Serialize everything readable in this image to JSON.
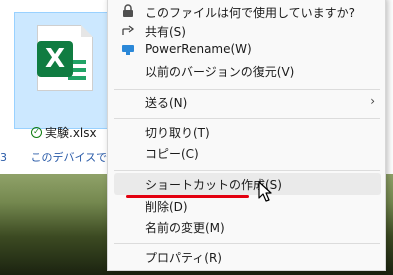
{
  "file": {
    "name": "実験.xlsx",
    "badge_letter": "X",
    "status_icon": "check-circle-icon"
  },
  "status_bar": {
    "left_number": "3",
    "text": "このデバイスで使用"
  },
  "context_menu": {
    "items": [
      {
        "label": "このファイルは何で使用していますか?",
        "icon": "lock-icon"
      },
      {
        "label": "共有(S)",
        "icon": "share-icon"
      },
      {
        "label": "PowerRename(W)",
        "icon": "powerrename-icon"
      },
      {
        "label": "以前のバージョンの復元(V)",
        "icon": ""
      },
      {
        "label": "送る(N)",
        "icon": "",
        "submenu_arrow": "›"
      },
      {
        "label": "切り取り(T)",
        "icon": ""
      },
      {
        "label": "コピー(C)",
        "icon": ""
      },
      {
        "label": "ショートカットの作成(S)",
        "icon": "",
        "highlighted": true
      },
      {
        "label": "削除(D)",
        "icon": ""
      },
      {
        "label": "名前の変更(M)",
        "icon": ""
      },
      {
        "label": "プロパティ(R)",
        "icon": ""
      }
    ]
  },
  "colors": {
    "excel_green": "#107c41",
    "selection_blue": "#cce8ff",
    "annotation_red": "#e3000f"
  }
}
